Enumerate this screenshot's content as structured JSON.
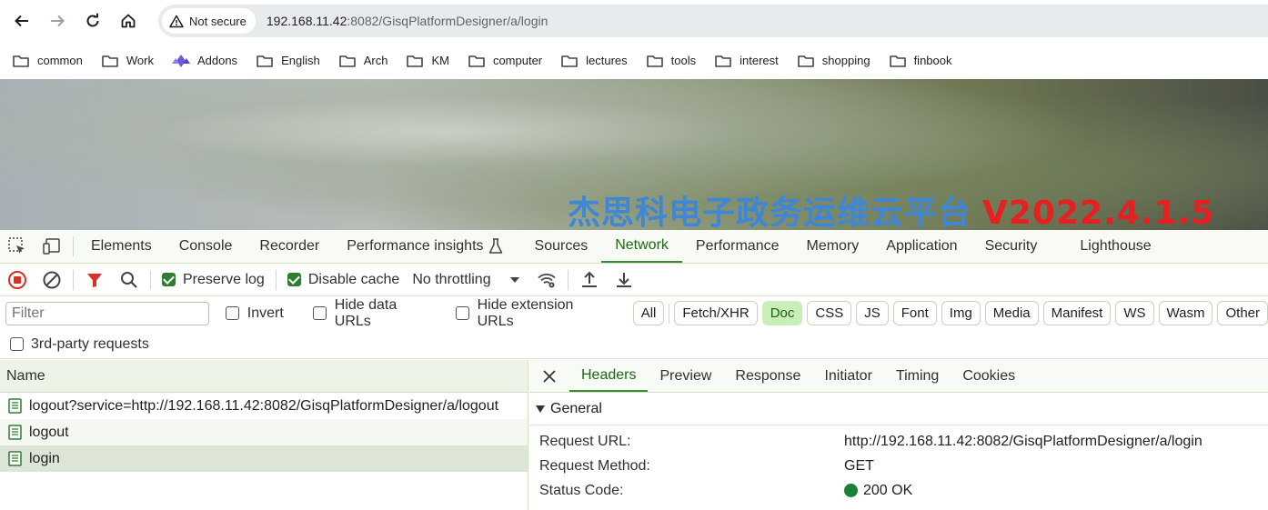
{
  "browser": {
    "security_label": "Not secure",
    "url_host": "192.168.11.42",
    "url_path": ":8082/GisqPlatformDesigner/a/login"
  },
  "bookmarks": [
    {
      "label": "common",
      "icon": "folder-icon"
    },
    {
      "label": "Work",
      "icon": "folder-icon"
    },
    {
      "label": "Addons",
      "icon": "addons-icon"
    },
    {
      "label": "English",
      "icon": "folder-icon"
    },
    {
      "label": "Arch",
      "icon": "folder-icon"
    },
    {
      "label": "KM",
      "icon": "folder-icon"
    },
    {
      "label": "computer",
      "icon": "folder-icon"
    },
    {
      "label": "lectures",
      "icon": "folder-icon"
    },
    {
      "label": "tools",
      "icon": "folder-icon"
    },
    {
      "label": "interest",
      "icon": "folder-icon"
    },
    {
      "label": "shopping",
      "icon": "folder-icon"
    },
    {
      "label": "finbook",
      "icon": "folder-icon"
    }
  ],
  "banner": {
    "title_cn": "杰思科电子政务运维云平台",
    "version": "V2022.4.1.5",
    "title_color": "#3d87d6",
    "version_color": "#e62020"
  },
  "devtools": {
    "tabs": [
      "Elements",
      "Console",
      "Recorder",
      "Performance insights",
      "Sources",
      "Network",
      "Performance",
      "Memory",
      "Application",
      "Security",
      "Lighthouse"
    ],
    "active_tab": "Network",
    "toolbar": {
      "preserve_log": "Preserve log",
      "disable_cache": "Disable cache",
      "throttling": "No throttling"
    },
    "filter": {
      "placeholder": "Filter",
      "invert": "Invert",
      "hide_data_urls": "Hide data URLs",
      "hide_extension_urls": "Hide extension URLs",
      "types": [
        "All",
        "Fetch/XHR",
        "Doc",
        "CSS",
        "JS",
        "Font",
        "Img",
        "Media",
        "Manifest",
        "WS",
        "Wasm",
        "Other"
      ],
      "selected_type": "Doc",
      "third_party": "3rd-party requests"
    },
    "requests": {
      "header": "Name",
      "rows": [
        "logout?service=http://192.168.11.42:8082/GisqPlatformDesigner/a/logout",
        "logout",
        "login"
      ]
    },
    "detail": {
      "tabs": [
        "Headers",
        "Preview",
        "Response",
        "Initiator",
        "Timing",
        "Cookies"
      ],
      "active_tab": "Headers",
      "section": "General",
      "fields": [
        {
          "key": "Request URL:",
          "value": "http://192.168.11.42:8082/GisqPlatformDesigner/a/login"
        },
        {
          "key": "Request Method:",
          "value": "GET"
        },
        {
          "key": "Status Code:",
          "value": "200 OK"
        }
      ]
    }
  }
}
